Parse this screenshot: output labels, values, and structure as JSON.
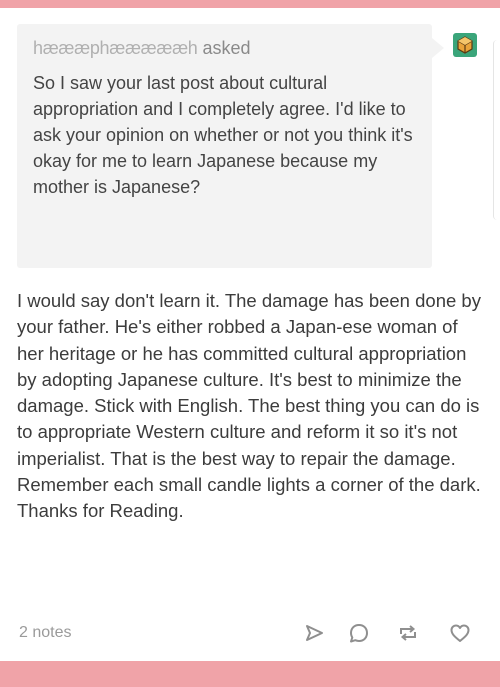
{
  "ask": {
    "asker_name": "hæææphæææææh",
    "asked_label": "asked",
    "question": "So I saw your last post about cultural appropriation and I completely agree. I'd like to ask your opinion on whether or not you think it's okay for me to learn Japanese because my mother is Japanese?"
  },
  "answer": {
    "text": "I would say don't learn it.  The damage has been done by your father.  He's either robbed a Japan-ese woman of her heritage or he has committed cultural appropriation by adopting Japanese culture.  It's best to minimize the damage.  Stick with English.  The best thing you can do is to appropriate Western culture and reform it so it's not  imperialist.  That is the best way to repair the damage.  Remember each small candle lights a corner of the dark.  Thanks for Reading."
  },
  "footer": {
    "notes": "2 notes",
    "icons": [
      "share-icon",
      "reply-icon",
      "reblog-icon",
      "like-icon"
    ]
  },
  "colors": {
    "accent_bar": "#f0a3a8",
    "ask_background": "#f3f3f3",
    "avatar": "#3aa57a"
  }
}
